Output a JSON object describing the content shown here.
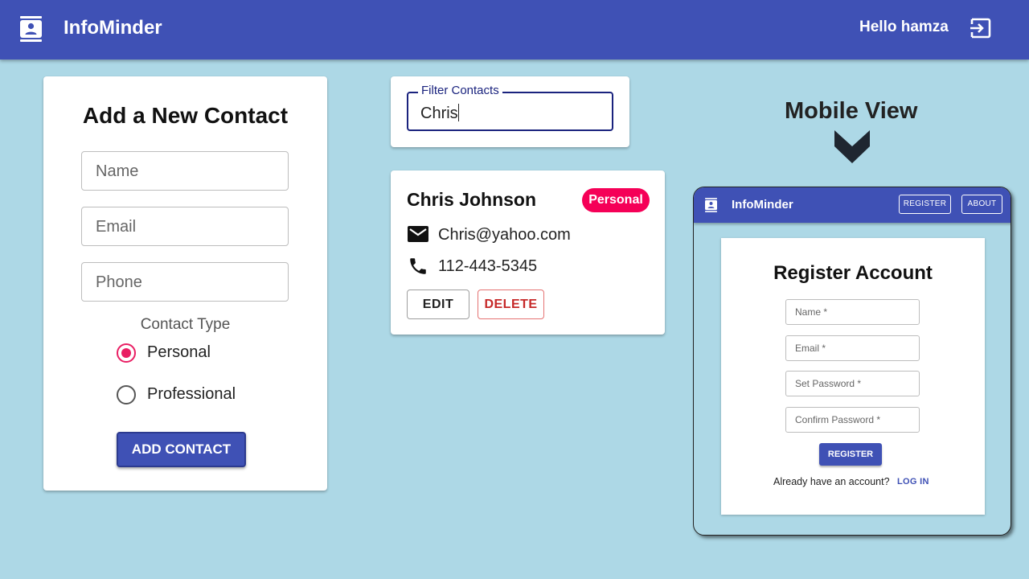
{
  "appbar": {
    "title": "InfoMinder",
    "greeting": "Hello hamza",
    "logo_icon": "contact-card-icon",
    "logout_icon": "logout-icon",
    "color": "#3f51b5"
  },
  "add_contact": {
    "title": "Add a New Contact",
    "name_placeholder": "Name",
    "email_placeholder": "Email",
    "phone_placeholder": "Phone",
    "type_label": "Contact Type",
    "type_options": [
      {
        "label": "Personal",
        "checked": true
      },
      {
        "label": "Professional",
        "checked": false
      }
    ],
    "submit_label": "ADD CONTACT"
  },
  "filter": {
    "label": "Filter Contacts",
    "value": "Chris"
  },
  "contact": {
    "name": "Chris Johnson",
    "type_badge": "Personal",
    "email": "Chris@yahoo.com",
    "phone": "112-443-5345",
    "edit_label": "EDIT",
    "delete_label": "DELETE",
    "badge_color": "#f50057"
  },
  "mobile_label": "Mobile View",
  "mobile": {
    "title": "InfoMinder",
    "nav_register": "REGISTER",
    "nav_about": "ABOUT",
    "card_title": "Register Account",
    "fields": [
      "Name *",
      "Email *",
      "Set Password *",
      "Confirm Password *"
    ],
    "register_label": "REGISTER",
    "already_text": "Already have an account?",
    "login_label": "LOG IN"
  }
}
